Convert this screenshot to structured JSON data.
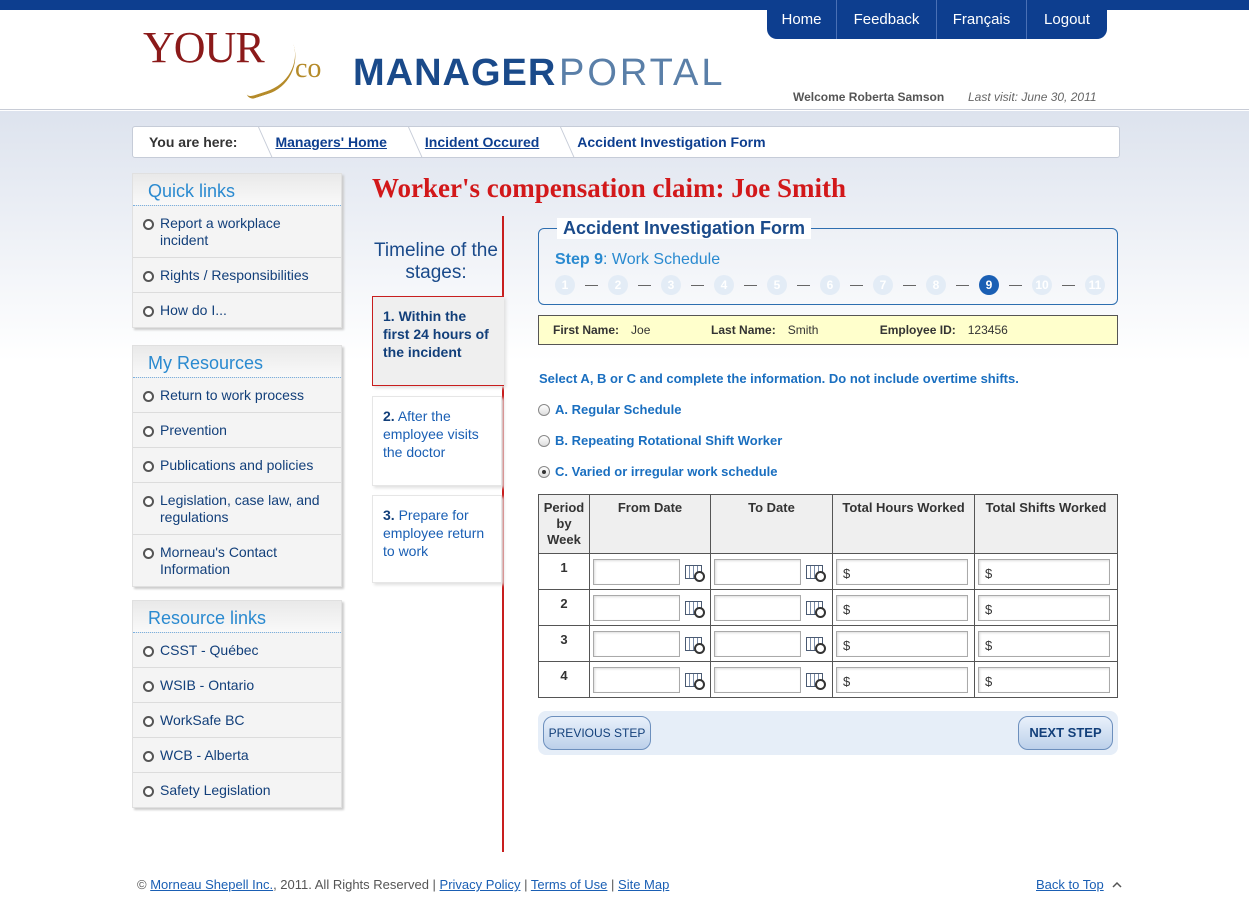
{
  "header": {
    "logo": {
      "your": "YOUR",
      "co": "co",
      "manager": "MANAGER",
      "portal": "PORTAL"
    },
    "nav": [
      "Home",
      "Feedback",
      "Français",
      "Logout"
    ],
    "welcome": "Welcome Roberta Samson",
    "last_visit": "Last visit: June 30, 2011"
  },
  "breadcrumb": {
    "label": "You are here:",
    "links": [
      "Managers' Home",
      "Incident Occured"
    ],
    "current": "Accident Investigation Form"
  },
  "sidebar": {
    "quick_links": {
      "title": "Quick links",
      "items": [
        "Report a workplace incident",
        "Rights / Responsibilities",
        "How do I..."
      ]
    },
    "my_resources": {
      "title": "My Resources",
      "items": [
        "Return to work process",
        "Prevention",
        "Publications and policies",
        "Legislation, case law, and regulations",
        "Morneau's Contact Information"
      ]
    },
    "resource_links": {
      "title": "Resource links",
      "items": [
        "CSST - Québec",
        "WSIB - Ontario",
        "WorkSafe BC",
        "WCB - Alberta",
        "Safety Legislation"
      ]
    }
  },
  "claim_title": "Worker's compensation claim: Joe Smith",
  "timeline": {
    "title": "Timeline of the stages:",
    "stages": [
      {
        "num": "1.",
        "text": "Within the first 24 hours of the incident"
      },
      {
        "num": "2.",
        "text": "After the employee visits the doctor"
      },
      {
        "num": "3.",
        "text": "Prepare for employee return to work"
      }
    ]
  },
  "form": {
    "title": "Accident Investigation Form",
    "step_label": "Step 9",
    "step_name": ": Work Schedule",
    "steps": [
      "1",
      "2",
      "3",
      "4",
      "5",
      "6",
      "7",
      "8",
      "9",
      "10",
      "11"
    ],
    "active_step": "9"
  },
  "employee": {
    "first_name_label": "First Name:",
    "first_name": "Joe",
    "last_name_label": "Last Name:",
    "last_name": "Smith",
    "id_label": "Employee ID:",
    "id": "123456"
  },
  "instruction": "Select A, B or C and complete the information. Do not include overtime shifts.",
  "options": [
    {
      "label": "A. Regular Schedule",
      "checked": false
    },
    {
      "label": "B. Repeating Rotational Shift Worker",
      "checked": false
    },
    {
      "label": "C. Varied or irregular work schedule",
      "checked": true
    }
  ],
  "table": {
    "headers": [
      "Period by Week",
      "From Date",
      "To Date",
      "Total Hours Worked",
      "Total Shifts Worked"
    ],
    "rows": [
      "1",
      "2",
      "3",
      "4"
    ],
    "currency_prefix": "$"
  },
  "buttons": {
    "previous": "PREVIOUS STEP",
    "next": "NEXT STEP"
  },
  "footer": {
    "copyright_symbol": "©",
    "company": "Morneau Shepell Inc.",
    "rights": ", 2011. All Rights Reserved |",
    "links": [
      "Privacy Policy",
      "Terms of Use",
      "Site Map"
    ],
    "back_to_top": "Back to Top"
  }
}
